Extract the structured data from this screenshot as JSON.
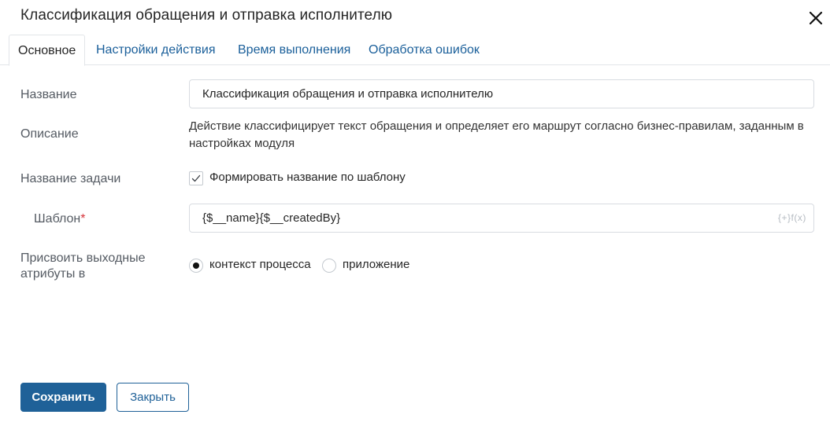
{
  "dialog": {
    "title": "Классификация обращения и отправка исполнителю"
  },
  "tabs": [
    {
      "label": "Основное",
      "active": true
    },
    {
      "label": "Настройки действия",
      "active": false
    },
    {
      "label": "Время выполнения",
      "active": false
    },
    {
      "label": "Обработка ошибок",
      "active": false
    }
  ],
  "form": {
    "name_label": "Название",
    "name_value": "Классификация обращения и отправка исполнителю",
    "description_label": "Описание",
    "description_text": "Действие классифицирует текст обращения и определяет его маршрут согласно бизнес-правилам, заданным в настройках модуля",
    "task_name_label": "Название задачи",
    "template_checkbox_label": "Формировать название по шаблону",
    "template_checkbox_checked": true,
    "template_label": "Шаблон",
    "template_required_mark": "*",
    "template_value": "{$__name}{$__createdBy}",
    "template_icons": "{+}f(x)",
    "assign_label_line1": "Присвоить выходные",
    "assign_label_line2": "атрибуты в",
    "assign_options": [
      {
        "label": "контекст процесса",
        "checked": true
      },
      {
        "label": "приложение",
        "checked": false
      }
    ]
  },
  "footer": {
    "save_label": "Сохранить",
    "close_label": "Закрыть"
  },
  "colors": {
    "accent": "#1f6198",
    "tab_link": "#1a5f9a",
    "required": "#d6333a"
  }
}
